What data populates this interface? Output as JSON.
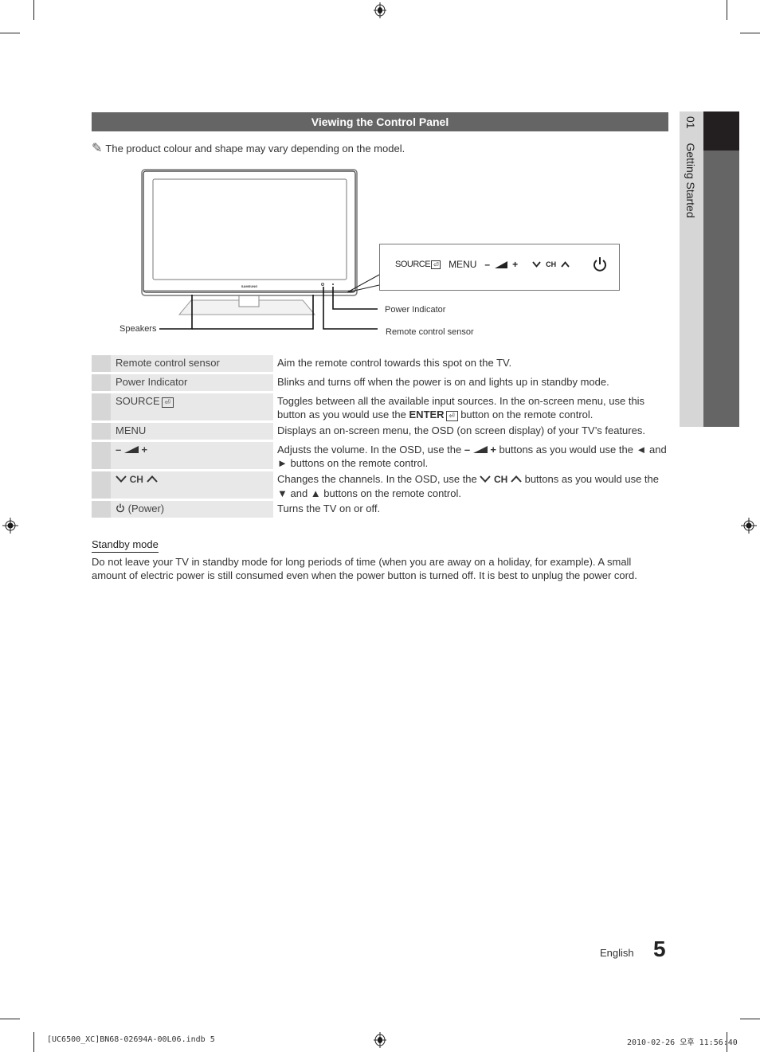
{
  "section": {
    "title": "Viewing the Control Panel",
    "note": "The product colour and shape may vary depending on the model.",
    "note_icon": "pencil-note-icon"
  },
  "side_tab": {
    "chapter_number": "01",
    "chapter_title": "Getting Started"
  },
  "diagram": {
    "brand_text": "SAMSUNG",
    "labels": {
      "speakers": "Speakers",
      "power_indicator": "Power Indicator",
      "remote_sensor": "Remote control sensor"
    },
    "panel": {
      "source": "SOURCE",
      "menu": "MENU",
      "vol_minus": "–",
      "vol_plus": "+",
      "ch": "CH"
    }
  },
  "table": {
    "rows": [
      {
        "name": "Remote control sensor",
        "desc": "Aim the remote control towards this spot on the TV."
      },
      {
        "name": "Power Indicator",
        "desc": "Blinks and turns off when the power is on and lights up in standby mode."
      },
      {
        "name": "SOURCE",
        "desc_a": "Toggles between all the available input sources. In the on-screen menu, use this button as you would use the ",
        "desc_bold": "ENTER",
        "desc_b": " button on the remote control."
      },
      {
        "name": "MENU",
        "desc": "Displays an on-screen menu, the OSD (on screen display) of your TV’s features."
      },
      {
        "name": "–  +",
        "desc_a": "Adjusts the volume. In the OSD, use the ",
        "desc_b": " buttons as you would use the ◄ and ► buttons on the remote control."
      },
      {
        "name": "CH",
        "desc_a": "Changes the channels. In the OSD, use the ",
        "desc_b": " buttons as you would use the ▼ and ▲ buttons on the remote control."
      },
      {
        "name": "(Power)",
        "desc": "Turns the TV on or off."
      }
    ]
  },
  "standby": {
    "title": "Standby mode",
    "text": "Do not leave your TV in standby mode for long periods of time (when you are away on a holiday, for example). A small amount of electric power is still consumed even when the power button is turned off. It is best to unplug the power cord."
  },
  "footer": {
    "language": "English",
    "page_number": "5"
  },
  "slug": {
    "file": "[UC6500_XC]BN68-02694A-00L06.indb   5",
    "timestamp": "2010-02-26   오후 11:56:40"
  }
}
